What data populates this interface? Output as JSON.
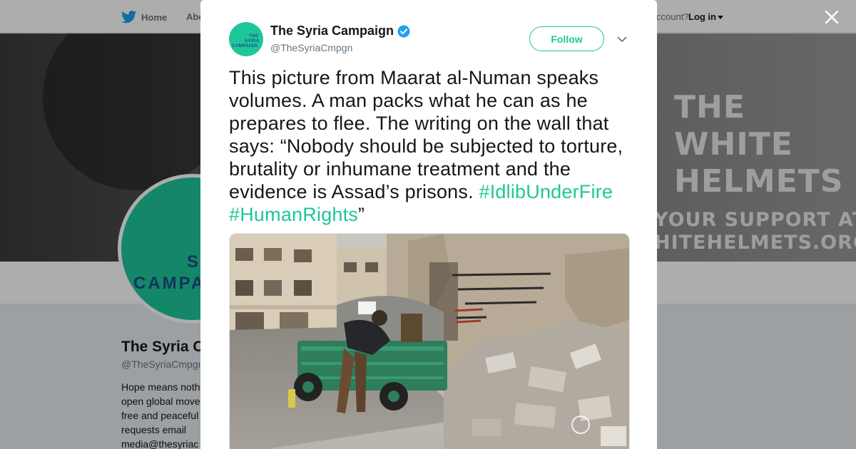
{
  "nav": {
    "home_label": "Home",
    "about_label": "Abo",
    "account_text": "ccount?",
    "login_label": "Log in"
  },
  "banner": {
    "line1": "THE",
    "line2": "WHITE",
    "line3": "HELMETS",
    "line4": "YOUR SUPPORT AT",
    "line5": "HITEHELMETS.ORG"
  },
  "profile": {
    "avatar_line1": "SY",
    "avatar_line2": "CAMPA",
    "name": "The Syria C",
    "handle": "@TheSyriaCmpgn",
    "bio_lines": [
      "Hope means noth",
      "open global move",
      "free and peaceful",
      "requests email",
      "media@thesyriac"
    ]
  },
  "tweet": {
    "avatar_line1": "THE",
    "avatar_line2": "SYRIA",
    "avatar_line3": "CAMPAIGN",
    "author_name": "The Syria Campaign",
    "author_handle": "@TheSyriaCmpgn",
    "follow_label": "Follow",
    "text": "This picture from Maarat al-Numan speaks volumes. A man packs what he can as he prepares to flee. The writing on the wall that says: “Nobody should be subjected to torture, brutality or inhumane treatment and the evidence is Assad’s prisons. ",
    "hashtag1": "#IdlibUnderFire",
    "hashtag2": "#HumanRights",
    "text_end": "”"
  },
  "colors": {
    "accent": "#1ec79a",
    "verified": "#1da1f2",
    "avatar_text": "#1a4d8a"
  },
  "icons": {
    "bird": "twitter-bird-icon",
    "verified": "verified-badge-icon",
    "menu": "chevron-down-icon",
    "close": "close-icon"
  }
}
